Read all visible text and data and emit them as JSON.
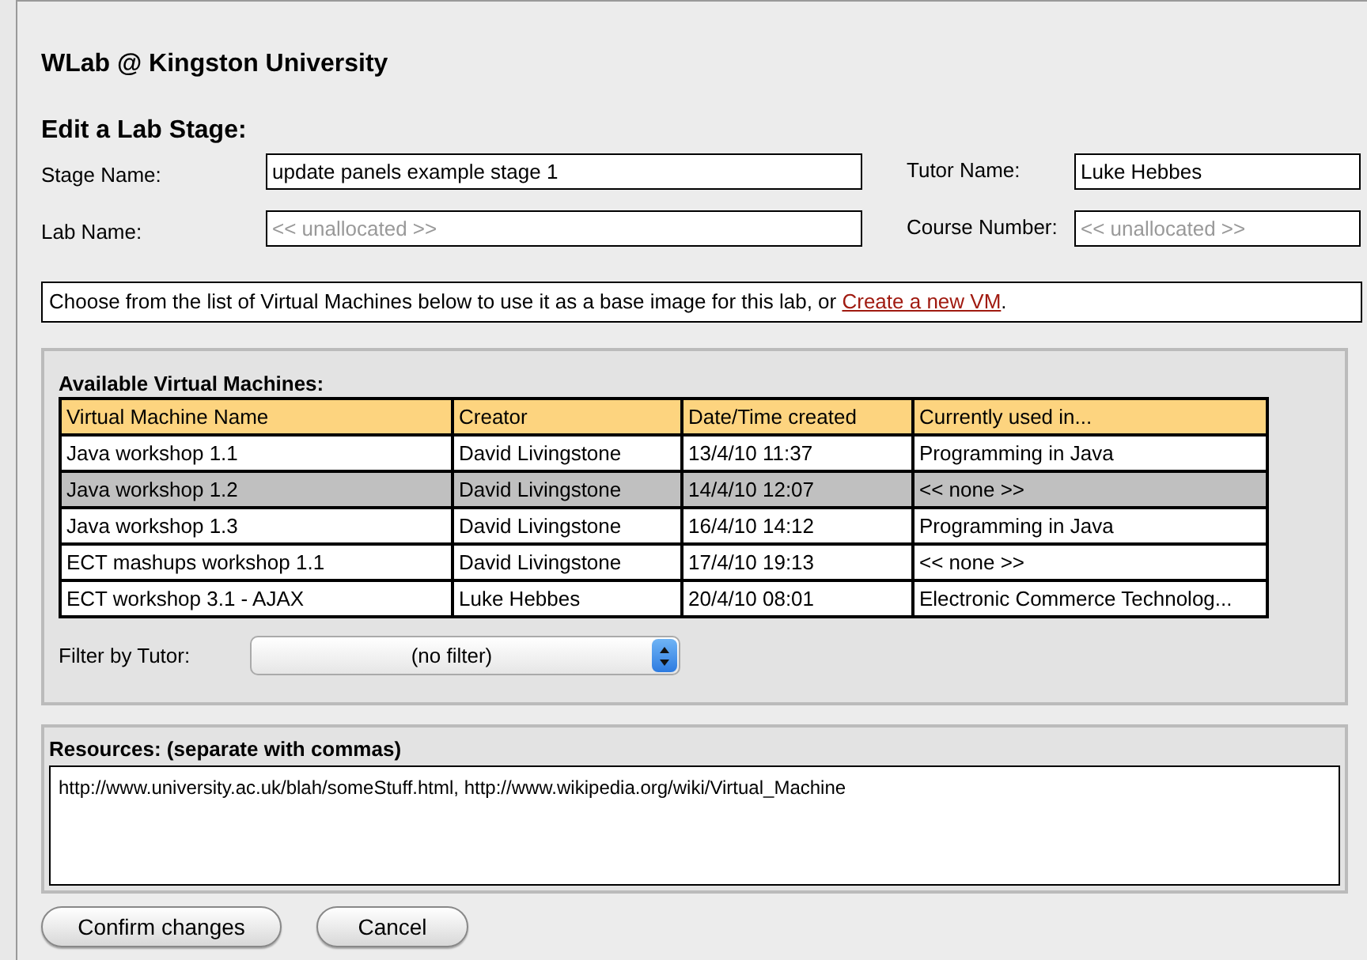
{
  "site_title": "WLab @ Kingston University",
  "heading": "Edit a Lab Stage:",
  "fields": [
    {
      "label": "Stage Name:",
      "value": "update panels example stage 1"
    },
    {
      "label": "Tutor Name:",
      "value": "Luke Hebbes"
    },
    {
      "label": "Lab Name:",
      "placeholder": "<< unallocated >>"
    },
    {
      "label": "Course Number:",
      "placeholder": "<< unallocated >>"
    }
  ],
  "info": {
    "text": "Choose from the list of Virtual Machines below to use it as a base image for this lab, or ",
    "link": "Create a new VM",
    "after": "."
  },
  "vm_panel": {
    "title": "Available Virtual Machines:",
    "columns": [
      "Virtual Machine Name",
      "Creator",
      "Date/Time created",
      "Currently used in..."
    ],
    "rows": [
      {
        "cells": [
          "Java workshop 1.1",
          "David Livingstone",
          "13/4/10 11:37",
          "Programming in Java"
        ],
        "selected": false
      },
      {
        "cells": [
          "Java workshop 1.2",
          "David Livingstone",
          "14/4/10 12:07",
          "<< none >>"
        ],
        "selected": true
      },
      {
        "cells": [
          "Java workshop 1.3",
          "David Livingstone",
          "16/4/10 14:12",
          "Programming in Java"
        ],
        "selected": false
      },
      {
        "cells": [
          "ECT mashups workshop 1.1",
          "David Livingstone",
          "17/4/10 19:13",
          "<< none >>"
        ],
        "selected": false
      },
      {
        "cells": [
          "ECT workshop 3.1 - AJAX",
          "Luke Hebbes",
          "20/4/10 08:01",
          "Electronic Commerce Technolog..."
        ],
        "selected": false
      }
    ],
    "filter": {
      "label": "Filter by Tutor:",
      "value": "(no filter)"
    }
  },
  "resources": {
    "title": "Resources: (separate with commas)",
    "value": "http://www.university.ac.uk/blah/someStuff.html, http://www.wikipedia.org/wiki/Virtual_Machine"
  },
  "buttons": [
    "Confirm changes",
    "Cancel"
  ]
}
